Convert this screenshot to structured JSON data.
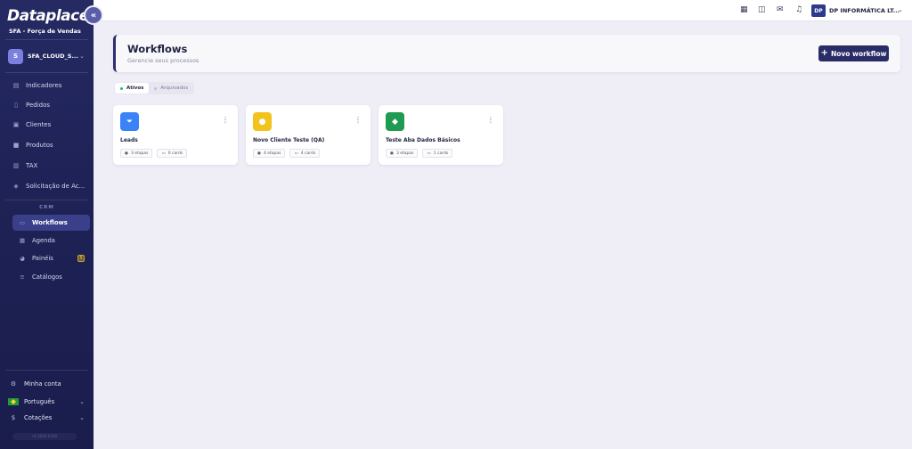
{
  "brand": {
    "logo": "Dataplace",
    "subtitle": "SFA - Força de Vendas"
  },
  "tenant": {
    "avatar": "S",
    "name": "SFA_CLOUD_S..."
  },
  "nav": [
    {
      "label": "Indicadores",
      "icon": "chart-icon"
    },
    {
      "label": "Pedidos",
      "icon": "document-icon"
    },
    {
      "label": "Clientes",
      "icon": "id-card-icon"
    },
    {
      "label": "Produtos",
      "icon": "box-icon"
    },
    {
      "label": "TAX",
      "icon": "tax-icon"
    },
    {
      "label": "Solicitação de Ac...",
      "icon": "shield-icon"
    }
  ],
  "crm": {
    "label": "CRM",
    "items": [
      {
        "label": "Workflows",
        "icon": "workflow-icon",
        "active": true
      },
      {
        "label": "Agenda",
        "icon": "calendar-icon"
      },
      {
        "label": "Painéis",
        "icon": "dashboard-icon",
        "badge": "5"
      },
      {
        "label": "Catálogos",
        "icon": "list-icon"
      }
    ]
  },
  "bottom": {
    "account": "Minha conta",
    "language": "Português",
    "quotes": "Cotações",
    "version": "v1.2026.0328"
  },
  "topbar": {
    "company": "DP INFORMÁTICA LT...",
    "company_logo": "DP"
  },
  "header": {
    "title": "Workflows",
    "subtitle": "Gerencie seus processos",
    "new_button": "Novo workflow"
  },
  "tabs": [
    {
      "label": "Ativos",
      "active": true,
      "dot_color": "#22b36a"
    },
    {
      "label": "Arquivados",
      "active": false,
      "dot_color": "#bfc1cf"
    }
  ],
  "cards": [
    {
      "title": "Leads",
      "stages": "3 etapas",
      "cards": "0 cards",
      "color": "#3b82f6",
      "icon": "filter-icon"
    },
    {
      "title": "Novo Cliente Teste (QA)",
      "stages": "4 etapas",
      "cards": "4 cards",
      "color": "#f2c31c",
      "icon": "user-icon"
    },
    {
      "title": "Teste Aba Dados Básicos",
      "stages": "3 etapas",
      "cards": "1 cards",
      "color": "#1f9a52",
      "icon": "layers-icon"
    }
  ]
}
